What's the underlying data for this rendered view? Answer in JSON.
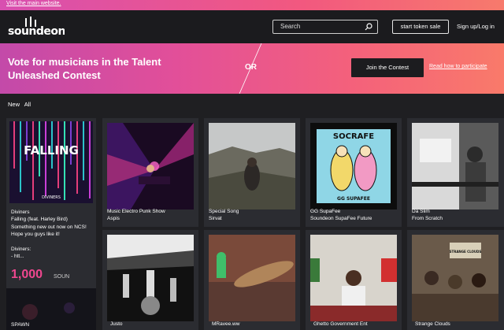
{
  "topstrip": {
    "link": "Visit the main website."
  },
  "nav": {
    "logo": "soundeon",
    "search_placeholder": "Search",
    "token_btn": "start token sale",
    "signup": "Sign up/Log in"
  },
  "banner": {
    "headline": "Vote for musicians in the Talent Unleashed Contest",
    "or": "OR",
    "join": "Join the Contest",
    "read": "Read how to participate"
  },
  "filters": [
    "New",
    "All"
  ],
  "featured": {
    "artist": "Diviners",
    "track": "Falling (feat. Harley Bird)",
    "desc": "Something new out now on NCS! Hope you guys like it!",
    "desc2": "Diviners:",
    "desc3": "- htt...",
    "price": "1,000",
    "unit": "SOUN",
    "bottom": "SPAWN"
  },
  "cards": [
    {
      "title": "Music Electro Punk Show",
      "sub": "Aspis"
    },
    {
      "title": "Special Song",
      "sub": "Sirvat"
    },
    {
      "title": "GG SupaFee",
      "sub": "Soundeon SupaFee Future"
    },
    {
      "title": "Da Slim",
      "sub": "From Scratch"
    }
  ],
  "bottom_cards": [
    "Justo",
    "MRavee.ww",
    "Ghetto Government Ent",
    "Strange Clouds"
  ],
  "art": {
    "falling": "FALLING",
    "diviners": "DIVINERS",
    "socrafe": "SOCRAFE",
    "gg": "GG SUPAFEE",
    "strange": "STRANGE CLOUDS"
  },
  "colors": {
    "accent": "#f0478f",
    "banner_start": "#c34aa9",
    "banner_end": "#f97a6a"
  }
}
